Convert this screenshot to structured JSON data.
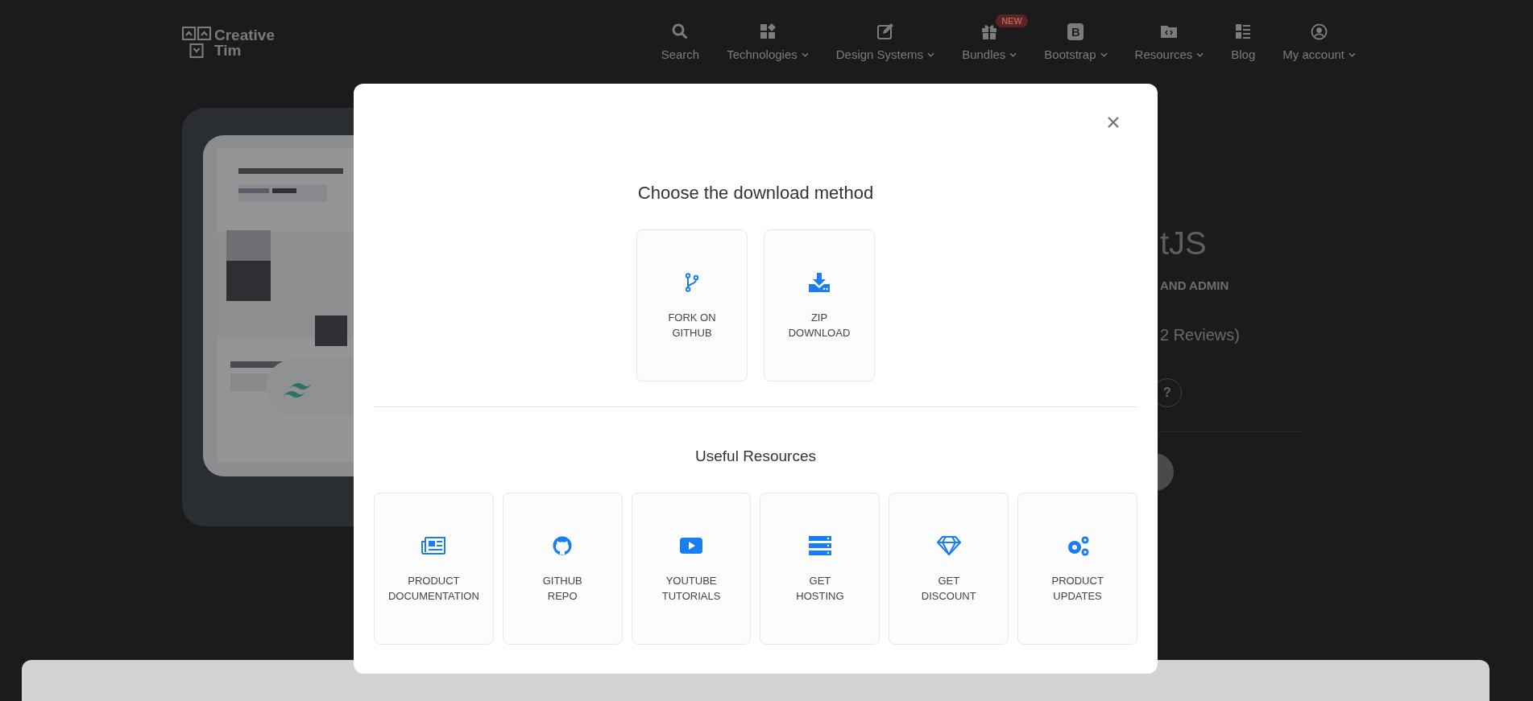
{
  "header": {
    "logo": "Creative Tim",
    "nav": [
      {
        "label": "Search",
        "dropdown": false
      },
      {
        "label": "Technologies",
        "dropdown": true
      },
      {
        "label": "Design Systems",
        "dropdown": true
      },
      {
        "label": "Bundles",
        "dropdown": true,
        "badge": "NEW"
      },
      {
        "label": "Bootstrap",
        "dropdown": true,
        "icon_letter": "B"
      },
      {
        "label": "Resources",
        "dropdown": true
      },
      {
        "label": "Blog",
        "dropdown": false
      },
      {
        "label": "My account",
        "dropdown": true
      }
    ]
  },
  "product": {
    "title_fragment": "tJS",
    "subtitle_fragment": "AND ADMIN",
    "reviews_fragment": "2 Reviews)",
    "help_badge": "?"
  },
  "modal": {
    "title": "Choose the download method",
    "download_options": [
      {
        "label": "FORK ON GITHUB"
      },
      {
        "label": "ZIP DOWNLOAD"
      }
    ],
    "resources_title": "Useful Resources",
    "resources": [
      {
        "label": "PRODUCT DOCUMENTATION"
      },
      {
        "label": "GITHUB REPO"
      },
      {
        "label": "YOUTUBE TUTORIALS"
      },
      {
        "label": "GET HOSTING"
      },
      {
        "label": "GET DISCOUNT"
      },
      {
        "label": "PRODUCT UPDATES"
      }
    ]
  }
}
